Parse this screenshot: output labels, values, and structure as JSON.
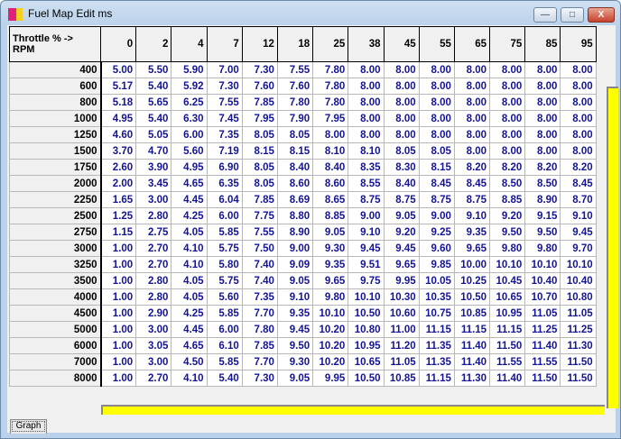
{
  "window": {
    "title": "Fuel Map Edit ms",
    "minimize": "—",
    "maximize": "□",
    "close": "X",
    "app_icon": "DTA"
  },
  "table": {
    "corner_line1": "Throttle % ->",
    "corner_line2": "RPM",
    "throttle": [
      "0",
      "2",
      "4",
      "7",
      "12",
      "18",
      "25",
      "38",
      "45",
      "55",
      "65",
      "75",
      "85",
      "95"
    ],
    "rows": [
      {
        "rpm": "400",
        "values": [
          "5.00",
          "5.50",
          "5.90",
          "7.00",
          "7.30",
          "7.55",
          "7.80",
          "8.00",
          "8.00",
          "8.00",
          "8.00",
          "8.00",
          "8.00",
          "8.00"
        ]
      },
      {
        "rpm": "600",
        "values": [
          "5.17",
          "5.40",
          "5.92",
          "7.30",
          "7.60",
          "7.60",
          "7.80",
          "8.00",
          "8.00",
          "8.00",
          "8.00",
          "8.00",
          "8.00",
          "8.00"
        ]
      },
      {
        "rpm": "800",
        "values": [
          "5.18",
          "5.65",
          "6.25",
          "7.55",
          "7.85",
          "7.80",
          "7.80",
          "8.00",
          "8.00",
          "8.00",
          "8.00",
          "8.00",
          "8.00",
          "8.00"
        ]
      },
      {
        "rpm": "1000",
        "values": [
          "4.95",
          "5.40",
          "6.30",
          "7.45",
          "7.95",
          "7.90",
          "7.95",
          "8.00",
          "8.00",
          "8.00",
          "8.00",
          "8.00",
          "8.00",
          "8.00"
        ]
      },
      {
        "rpm": "1250",
        "values": [
          "4.60",
          "5.05",
          "6.00",
          "7.35",
          "8.05",
          "8.05",
          "8.00",
          "8.00",
          "8.00",
          "8.00",
          "8.00",
          "8.00",
          "8.00",
          "8.00"
        ]
      },
      {
        "rpm": "1500",
        "values": [
          "3.70",
          "4.70",
          "5.60",
          "7.19",
          "8.15",
          "8.15",
          "8.10",
          "8.10",
          "8.05",
          "8.05",
          "8.00",
          "8.00",
          "8.00",
          "8.00"
        ]
      },
      {
        "rpm": "1750",
        "values": [
          "2.60",
          "3.90",
          "4.95",
          "6.90",
          "8.05",
          "8.40",
          "8.40",
          "8.35",
          "8.30",
          "8.15",
          "8.20",
          "8.20",
          "8.20",
          "8.20"
        ]
      },
      {
        "rpm": "2000",
        "values": [
          "2.00",
          "3.45",
          "4.65",
          "6.35",
          "8.05",
          "8.60",
          "8.60",
          "8.55",
          "8.40",
          "8.45",
          "8.45",
          "8.50",
          "8.50",
          "8.45"
        ]
      },
      {
        "rpm": "2250",
        "values": [
          "1.65",
          "3.00",
          "4.45",
          "6.04",
          "7.85",
          "8.69",
          "8.65",
          "8.75",
          "8.75",
          "8.75",
          "8.75",
          "8.85",
          "8.90",
          "8.70"
        ]
      },
      {
        "rpm": "2500",
        "values": [
          "1.25",
          "2.80",
          "4.25",
          "6.00",
          "7.75",
          "8.80",
          "8.85",
          "9.00",
          "9.05",
          "9.00",
          "9.10",
          "9.20",
          "9.15",
          "9.10"
        ]
      },
      {
        "rpm": "2750",
        "values": [
          "1.15",
          "2.75",
          "4.05",
          "5.85",
          "7.55",
          "8.90",
          "9.05",
          "9.10",
          "9.20",
          "9.25",
          "9.35",
          "9.50",
          "9.50",
          "9.45"
        ]
      },
      {
        "rpm": "3000",
        "values": [
          "1.00",
          "2.70",
          "4.10",
          "5.75",
          "7.50",
          "9.00",
          "9.30",
          "9.45",
          "9.45",
          "9.60",
          "9.65",
          "9.80",
          "9.80",
          "9.70"
        ]
      },
      {
        "rpm": "3250",
        "values": [
          "1.00",
          "2.70",
          "4.10",
          "5.80",
          "7.40",
          "9.09",
          "9.35",
          "9.51",
          "9.65",
          "9.85",
          "10.00",
          "10.10",
          "10.10",
          "10.10"
        ]
      },
      {
        "rpm": "3500",
        "values": [
          "1.00",
          "2.80",
          "4.05",
          "5.75",
          "7.40",
          "9.05",
          "9.65",
          "9.75",
          "9.95",
          "10.05",
          "10.25",
          "10.45",
          "10.40",
          "10.40"
        ]
      },
      {
        "rpm": "4000",
        "values": [
          "1.00",
          "2.80",
          "4.05",
          "5.60",
          "7.35",
          "9.10",
          "9.80",
          "10.10",
          "10.30",
          "10.35",
          "10.50",
          "10.65",
          "10.70",
          "10.80"
        ]
      },
      {
        "rpm": "4500",
        "values": [
          "1.00",
          "2.90",
          "4.25",
          "5.85",
          "7.70",
          "9.35",
          "10.10",
          "10.50",
          "10.60",
          "10.75",
          "10.85",
          "10.95",
          "11.05",
          "11.05"
        ]
      },
      {
        "rpm": "5000",
        "values": [
          "1.00",
          "3.00",
          "4.45",
          "6.00",
          "7.80",
          "9.45",
          "10.20",
          "10.80",
          "11.00",
          "11.15",
          "11.15",
          "11.15",
          "11.25",
          "11.25"
        ]
      },
      {
        "rpm": "6000",
        "values": [
          "1.00",
          "3.05",
          "4.65",
          "6.10",
          "7.85",
          "9.50",
          "10.20",
          "10.95",
          "11.20",
          "11.35",
          "11.40",
          "11.50",
          "11.40",
          "11.30"
        ]
      },
      {
        "rpm": "7000",
        "values": [
          "1.00",
          "3.00",
          "4.50",
          "5.85",
          "7.70",
          "9.30",
          "10.20",
          "10.65",
          "11.05",
          "11.35",
          "11.40",
          "11.55",
          "11.55",
          "11.50"
        ]
      },
      {
        "rpm": "8000",
        "values": [
          "1.00",
          "2.70",
          "4.10",
          "5.40",
          "7.30",
          "9.05",
          "9.95",
          "10.50",
          "10.85",
          "11.15",
          "11.30",
          "11.40",
          "11.50",
          "11.50"
        ]
      }
    ]
  },
  "graph_button": "Graph",
  "colors": {
    "value_text": "#141496",
    "indicator": "#ffff00"
  }
}
